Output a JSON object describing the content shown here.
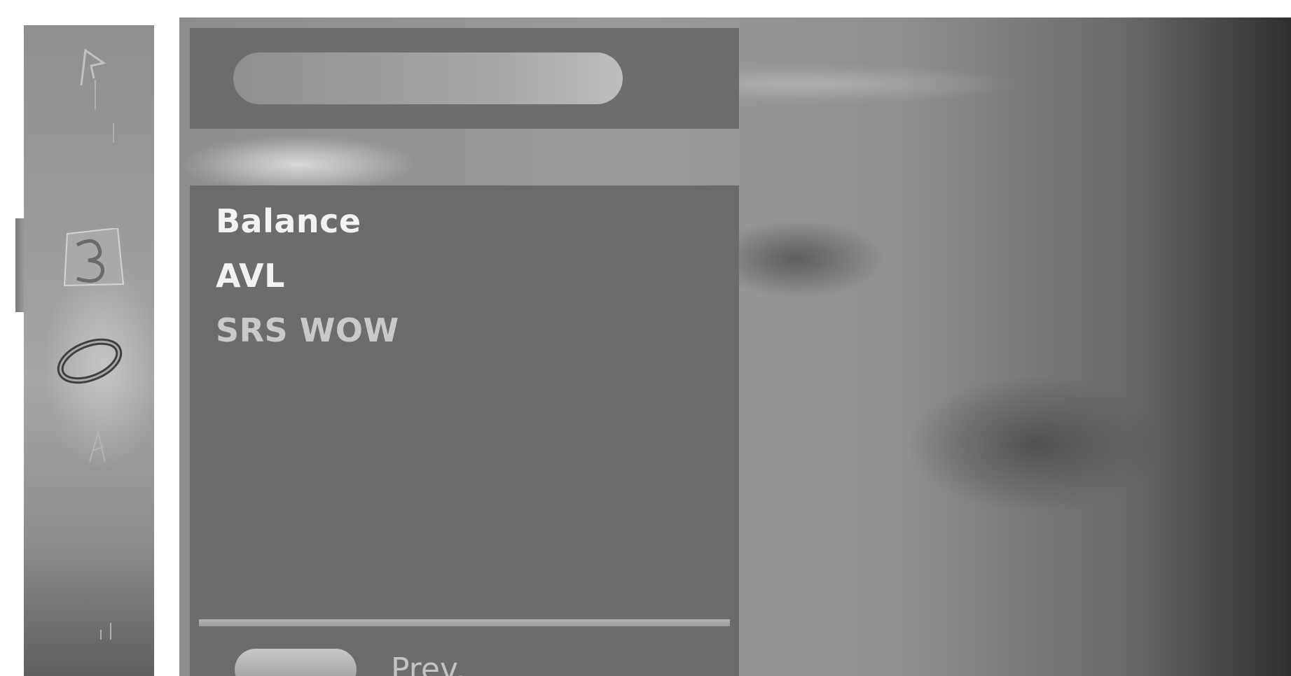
{
  "sidebar": {
    "icons": [
      {
        "name": "picture-menu-icon",
        "selected": false
      },
      {
        "name": "audio-menu-icon",
        "selected": true
      },
      {
        "name": "time-menu-icon",
        "selected": false
      },
      {
        "name": "special-menu-icon",
        "selected": false
      }
    ]
  },
  "menu": {
    "title": "",
    "items": [
      {
        "label": "Balance"
      },
      {
        "label": "AVL"
      },
      {
        "label": "SRS WOW"
      }
    ]
  },
  "footer": {
    "prev_label": "Prev."
  }
}
